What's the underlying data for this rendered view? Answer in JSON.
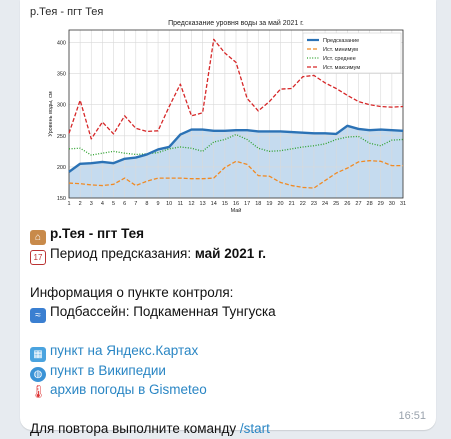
{
  "message": {
    "header": "р.Тея - пгт Тея",
    "time": "16:51",
    "lines": {
      "station": "р.Тея - пгт Тея",
      "period_label": "Период предсказания: ",
      "period_value": "май 2021 г.",
      "info_title": "Информация о пункте контроля:",
      "subbasin": "Подбассейн: Подкаменная Тунгуска",
      "link_map": "пункт на Яндекс.Картах",
      "link_wiki": "пункт в Википедии",
      "link_weather": "архив погоды в Gismeteo",
      "repeat_text": "Для повтора выполните команду ",
      "repeat_cmd": "/start"
    },
    "icons": {
      "station": "house-icon",
      "period": "calendar-icon",
      "subbasin": "wave-icon",
      "map": "map-icon",
      "wiki": "globe-icon",
      "weather": "thermometer-icon"
    }
  },
  "chart_data": {
    "type": "line",
    "title": "Предсказание уровня воды за май 2021 г.",
    "xlabel": "Май",
    "ylabel": "Уровень воды, см",
    "x": [
      1,
      2,
      3,
      4,
      5,
      6,
      7,
      8,
      9,
      10,
      11,
      12,
      13,
      14,
      15,
      16,
      17,
      18,
      19,
      20,
      21,
      22,
      23,
      24,
      25,
      26,
      27,
      28,
      29,
      30,
      31
    ],
    "xlim": [
      1,
      31
    ],
    "ylim": [
      150,
      420
    ],
    "yticks": [
      150,
      200,
      250,
      300,
      350,
      400
    ],
    "grid": true,
    "legend_position": "top-right",
    "series": [
      {
        "name": "Предсказание",
        "color": "#2b72b5",
        "style": "solid",
        "fill": "#c5dbef",
        "values": [
          192,
          205,
          206,
          208,
          206,
          213,
          215,
          220,
          228,
          232,
          252,
          260,
          260,
          258,
          258,
          259,
          259,
          257,
          257,
          257,
          256,
          255,
          254,
          254,
          253,
          266,
          261,
          259,
          260,
          259,
          258
        ]
      },
      {
        "name": "Ист. минимум",
        "color": "#f08a24",
        "style": "dashed",
        "values": [
          174,
          173,
          171,
          170,
          172,
          182,
          170,
          177,
          182,
          182,
          182,
          181,
          181,
          182,
          199,
          209,
          204,
          186,
          185,
          175,
          170,
          167,
          166,
          178,
          190,
          198,
          208,
          210,
          209,
          202,
          202
        ]
      },
      {
        "name": "Ист. среднее",
        "color": "#2ca02c",
        "style": "dotted",
        "values": [
          229,
          230,
          219,
          222,
          225,
          222,
          220,
          221,
          223,
          229,
          232,
          230,
          225,
          240,
          244,
          252,
          244,
          230,
          225,
          226,
          229,
          232,
          234,
          237,
          244,
          248,
          249,
          238,
          234,
          243,
          244
        ]
      },
      {
        "name": "Ист. максимум",
        "color": "#d62728",
        "style": "dashed",
        "values": [
          254,
          307,
          245,
          272,
          253,
          282,
          262,
          257,
          258,
          297,
          333,
          282,
          287,
          405,
          383,
          368,
          310,
          290,
          305,
          325,
          326,
          345,
          347,
          335,
          326,
          315,
          305,
          300,
          297,
          296,
          297
        ]
      }
    ]
  }
}
